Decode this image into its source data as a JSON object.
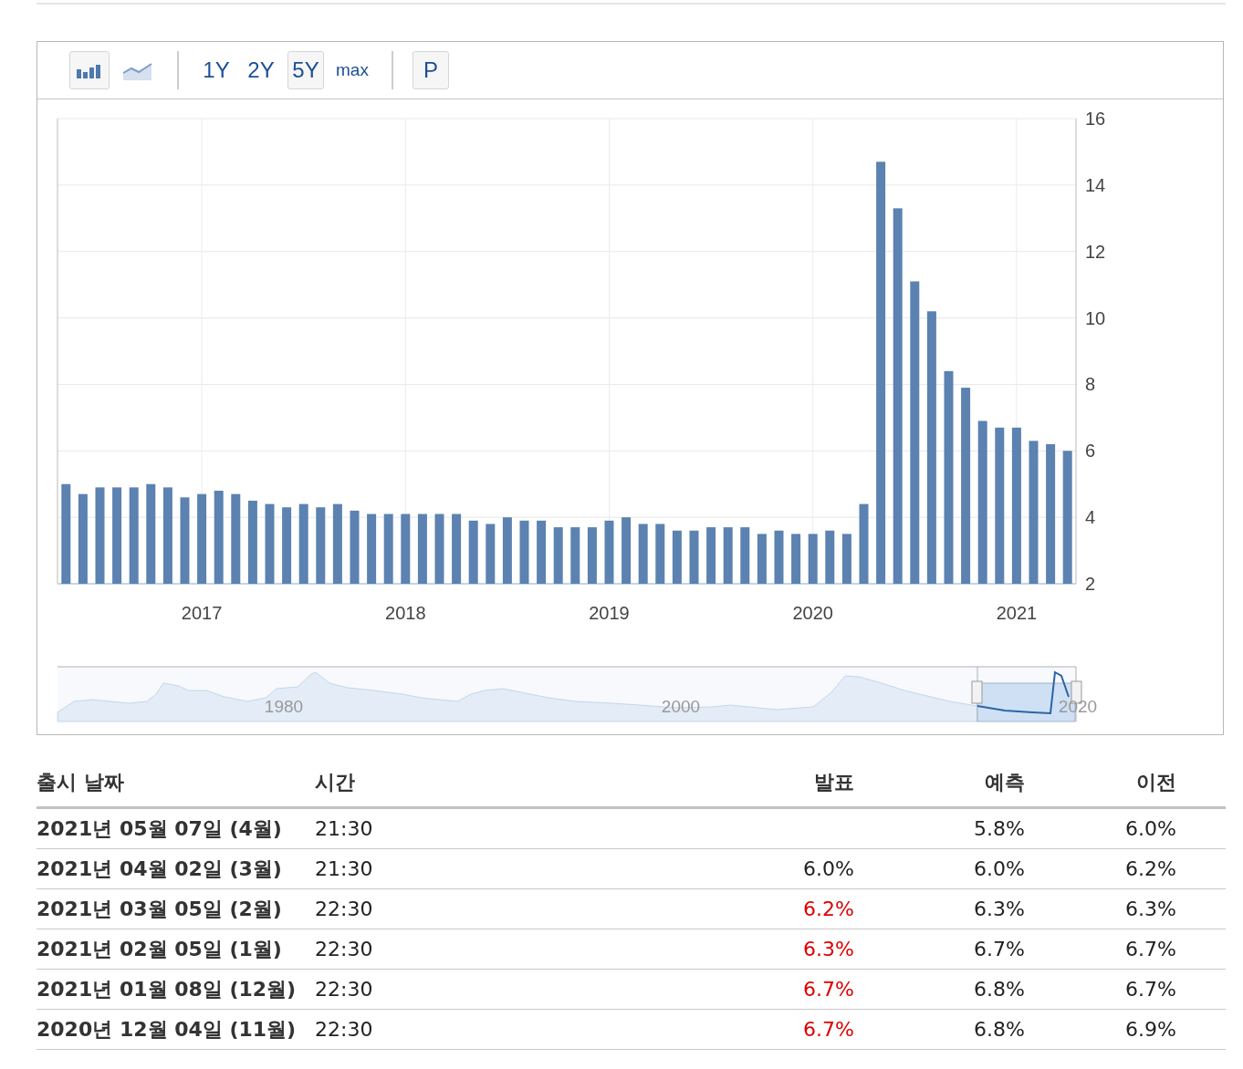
{
  "toolbar": {
    "chart_types": [
      {
        "kind": "bar",
        "selected": true
      },
      {
        "kind": "line",
        "selected": false
      }
    ],
    "ranges": [
      {
        "label": "1Y",
        "selected": false
      },
      {
        "label": "2Y",
        "selected": false
      },
      {
        "label": "5Y",
        "selected": true
      },
      {
        "label": "max",
        "selected": false
      }
    ],
    "p_button": "P"
  },
  "chart": {
    "chart_data": {
      "type": "bar",
      "x": [
        "2016-05",
        "2016-06",
        "2016-07",
        "2016-08",
        "2016-09",
        "2016-10",
        "2016-11",
        "2016-12",
        "2017-01",
        "2017-02",
        "2017-03",
        "2017-04",
        "2017-05",
        "2017-06",
        "2017-07",
        "2017-08",
        "2017-09",
        "2017-10",
        "2017-11",
        "2017-12",
        "2018-01",
        "2018-02",
        "2018-03",
        "2018-04",
        "2018-05",
        "2018-06",
        "2018-07",
        "2018-08",
        "2018-09",
        "2018-10",
        "2018-11",
        "2018-12",
        "2019-01",
        "2019-02",
        "2019-03",
        "2019-04",
        "2019-05",
        "2019-06",
        "2019-07",
        "2019-08",
        "2019-09",
        "2019-10",
        "2019-11",
        "2019-12",
        "2020-01",
        "2020-02",
        "2020-03",
        "2020-04",
        "2020-05",
        "2020-06",
        "2020-07",
        "2020-08",
        "2020-09",
        "2020-10",
        "2020-11",
        "2020-12",
        "2021-01",
        "2021-02",
        "2021-03",
        "2021-04"
      ],
      "series": [
        {
          "color": "#5b82b0",
          "values": [
            5.0,
            4.7,
            4.9,
            4.9,
            4.9,
            5.0,
            4.9,
            4.6,
            4.7,
            4.8,
            4.7,
            4.5,
            4.4,
            4.3,
            4.4,
            4.3,
            4.4,
            4.2,
            4.1,
            4.1,
            4.1,
            4.1,
            4.1,
            4.1,
            3.9,
            3.8,
            4.0,
            3.9,
            3.9,
            3.7,
            3.7,
            3.7,
            3.9,
            4.0,
            3.8,
            3.8,
            3.6,
            3.6,
            3.7,
            3.7,
            3.7,
            3.5,
            3.6,
            3.5,
            3.5,
            3.6,
            3.5,
            4.4,
            14.7,
            13.3,
            11.1,
            10.2,
            8.4,
            7.9,
            6.9,
            6.7,
            6.7,
            6.3,
            6.2,
            6.0
          ]
        }
      ],
      "xlim": [
        "2016-05",
        "2021-04"
      ],
      "grid": true,
      "ylim": [
        2,
        16
      ],
      "yticks": [
        2,
        4,
        6,
        8,
        10,
        12,
        14,
        16
      ],
      "xticks": [
        {
          "value": "2017-01",
          "label": "2017"
        },
        {
          "value": "2018-01",
          "label": "2018"
        },
        {
          "value": "2019-01",
          "label": "2019"
        },
        {
          "value": "2020-01",
          "label": "2020"
        },
        {
          "value": "2021-01",
          "label": "2021"
        }
      ]
    }
  },
  "navigator": {
    "labels": [
      "1980",
      "2000",
      "2020"
    ]
  },
  "table": {
    "columns": [
      "출시 날짜",
      "시간",
      "발표",
      "예측",
      "이전"
    ],
    "rows": [
      {
        "date": "2021년 05월 07일 (4월)",
        "time": "21:30",
        "forecast": "5.8%",
        "previous": "6.0%"
      },
      {
        "date": "2021년 04월 02일 (3월)",
        "time": "21:30",
        "actual": "6.0%",
        "color": "#222222",
        "forecast": "6.0%",
        "previous": "6.2%"
      },
      {
        "date": "2021년 03월 05일 (2월)",
        "time": "22:30",
        "actual": "6.2%",
        "color": "#dd0000",
        "forecast": "6.3%",
        "previous": "6.3%"
      },
      {
        "date": "2021년 02월 05일 (1월)",
        "time": "22:30",
        "actual": "6.3%",
        "color": "#dd0000",
        "forecast": "6.7%",
        "previous": "6.7%"
      },
      {
        "date": "2021년 01월 08일 (12월)",
        "time": "22:30",
        "actual": "6.7%",
        "color": "#dd0000",
        "forecast": "6.8%",
        "previous": "6.7%"
      },
      {
        "date": "2020년 12월 04일 (11월)",
        "time": "22:30",
        "actual": "6.7%",
        "color": "#dd0000",
        "forecast": "6.8%",
        "previous": "6.9%"
      }
    ]
  }
}
